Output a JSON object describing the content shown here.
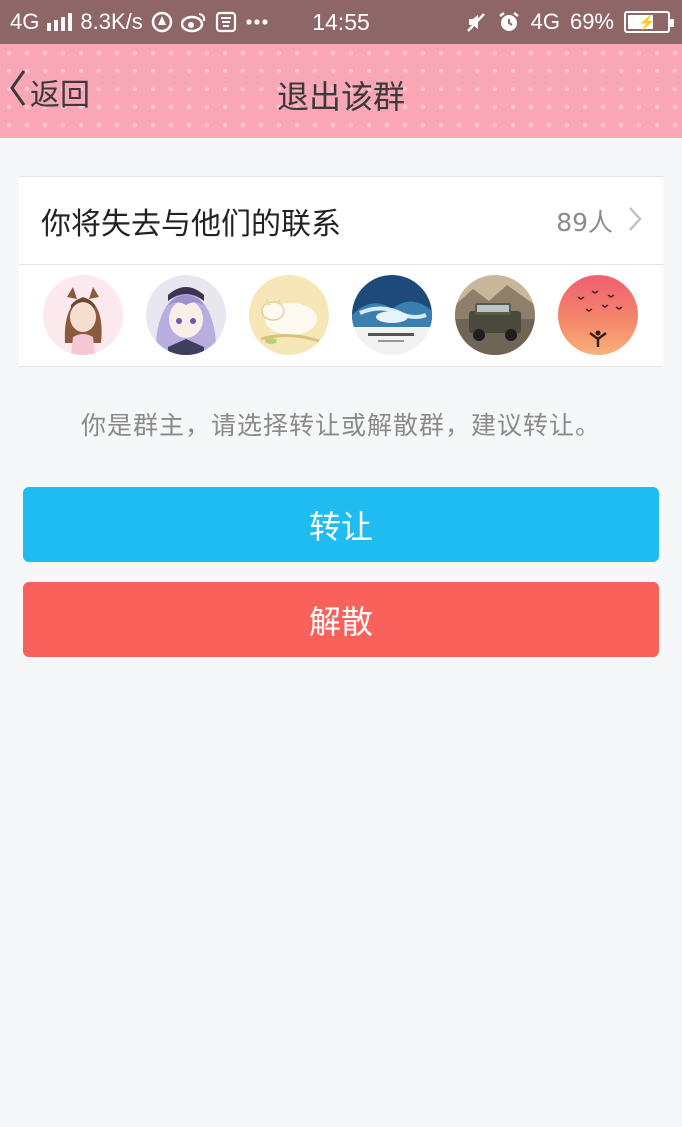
{
  "status_bar": {
    "network": "4G",
    "speed": "8.3K/s",
    "time": "14:55",
    "network_right": "4G",
    "battery": "69%",
    "battery_level": 0.69,
    "icons": [
      "signal-icon",
      "app-notification-icon",
      "weibo-icon",
      "tieba-icon",
      "more-icon",
      "mute-icon",
      "alarm-icon",
      "battery-icon"
    ]
  },
  "nav": {
    "back_label": "返回",
    "title": "退出该群"
  },
  "members": {
    "label": "你将失去与他们的联系",
    "count": "89人",
    "avatars": [
      "avatar-1",
      "avatar-2",
      "avatar-3",
      "avatar-4",
      "avatar-5",
      "avatar-6"
    ]
  },
  "hint": "你是群主，请选择转让或解散群，建议转让。",
  "actions": {
    "transfer_label": "转让",
    "dissolve_label": "解散"
  },
  "colors": {
    "status_bar": "#8e6668",
    "nav_bar": "#f9a7b7",
    "transfer": "#1ebcf0",
    "dissolve": "#f8625a",
    "background": "#f6f7f9"
  }
}
